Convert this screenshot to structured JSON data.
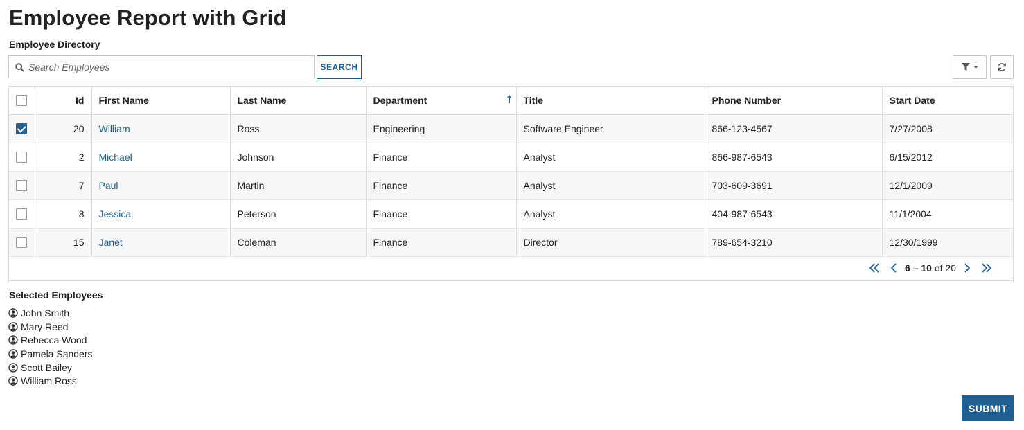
{
  "page": {
    "title": "Employee Report with Grid"
  },
  "directory": {
    "label": "Employee Directory",
    "search_placeholder": "Search Employees",
    "search_value": "",
    "search_button": "SEARCH",
    "filter_icon": "filter-icon",
    "refresh_icon": "refresh-icon"
  },
  "grid": {
    "columns": {
      "select": "",
      "id": "Id",
      "first_name": "First Name",
      "last_name": "Last Name",
      "department": "Department",
      "title": "Title",
      "phone": "Phone Number",
      "start_date": "Start Date"
    },
    "sort": {
      "column": "Department",
      "direction": "ascending"
    },
    "rows": [
      {
        "checked": true,
        "id": "20",
        "first_name": "William",
        "last_name": "Ross",
        "department": "Engineering",
        "title": "Software Engineer",
        "phone": "866-123-4567",
        "start_date": "7/27/2008"
      },
      {
        "checked": false,
        "id": "2",
        "first_name": "Michael",
        "last_name": "Johnson",
        "department": "Finance",
        "title": "Analyst",
        "phone": "866-987-6543",
        "start_date": "6/15/2012"
      },
      {
        "checked": false,
        "id": "7",
        "first_name": "Paul",
        "last_name": "Martin",
        "department": "Finance",
        "title": "Analyst",
        "phone": "703-609-3691",
        "start_date": "12/1/2009"
      },
      {
        "checked": false,
        "id": "8",
        "first_name": "Jessica",
        "last_name": "Peterson",
        "department": "Finance",
        "title": "Analyst",
        "phone": "404-987-6543",
        "start_date": "11/1/2004"
      },
      {
        "checked": false,
        "id": "15",
        "first_name": "Janet",
        "last_name": "Coleman",
        "department": "Finance",
        "title": "Director",
        "phone": "789-654-3210",
        "start_date": "12/30/1999"
      }
    ],
    "pager": {
      "range": "6 – 10",
      "of_label": "of",
      "total": "20"
    }
  },
  "selected": {
    "label": "Selected Employees",
    "items": [
      "John Smith",
      "Mary Reed",
      "Rebecca Wood",
      "Pamela Sanders",
      "Scott Bailey",
      "William Ross"
    ]
  },
  "actions": {
    "submit": "SUBMIT"
  },
  "colors": {
    "accent": "#1f5f92",
    "border": "#dcdcdc",
    "row_stripe": "#f7f7f7"
  }
}
